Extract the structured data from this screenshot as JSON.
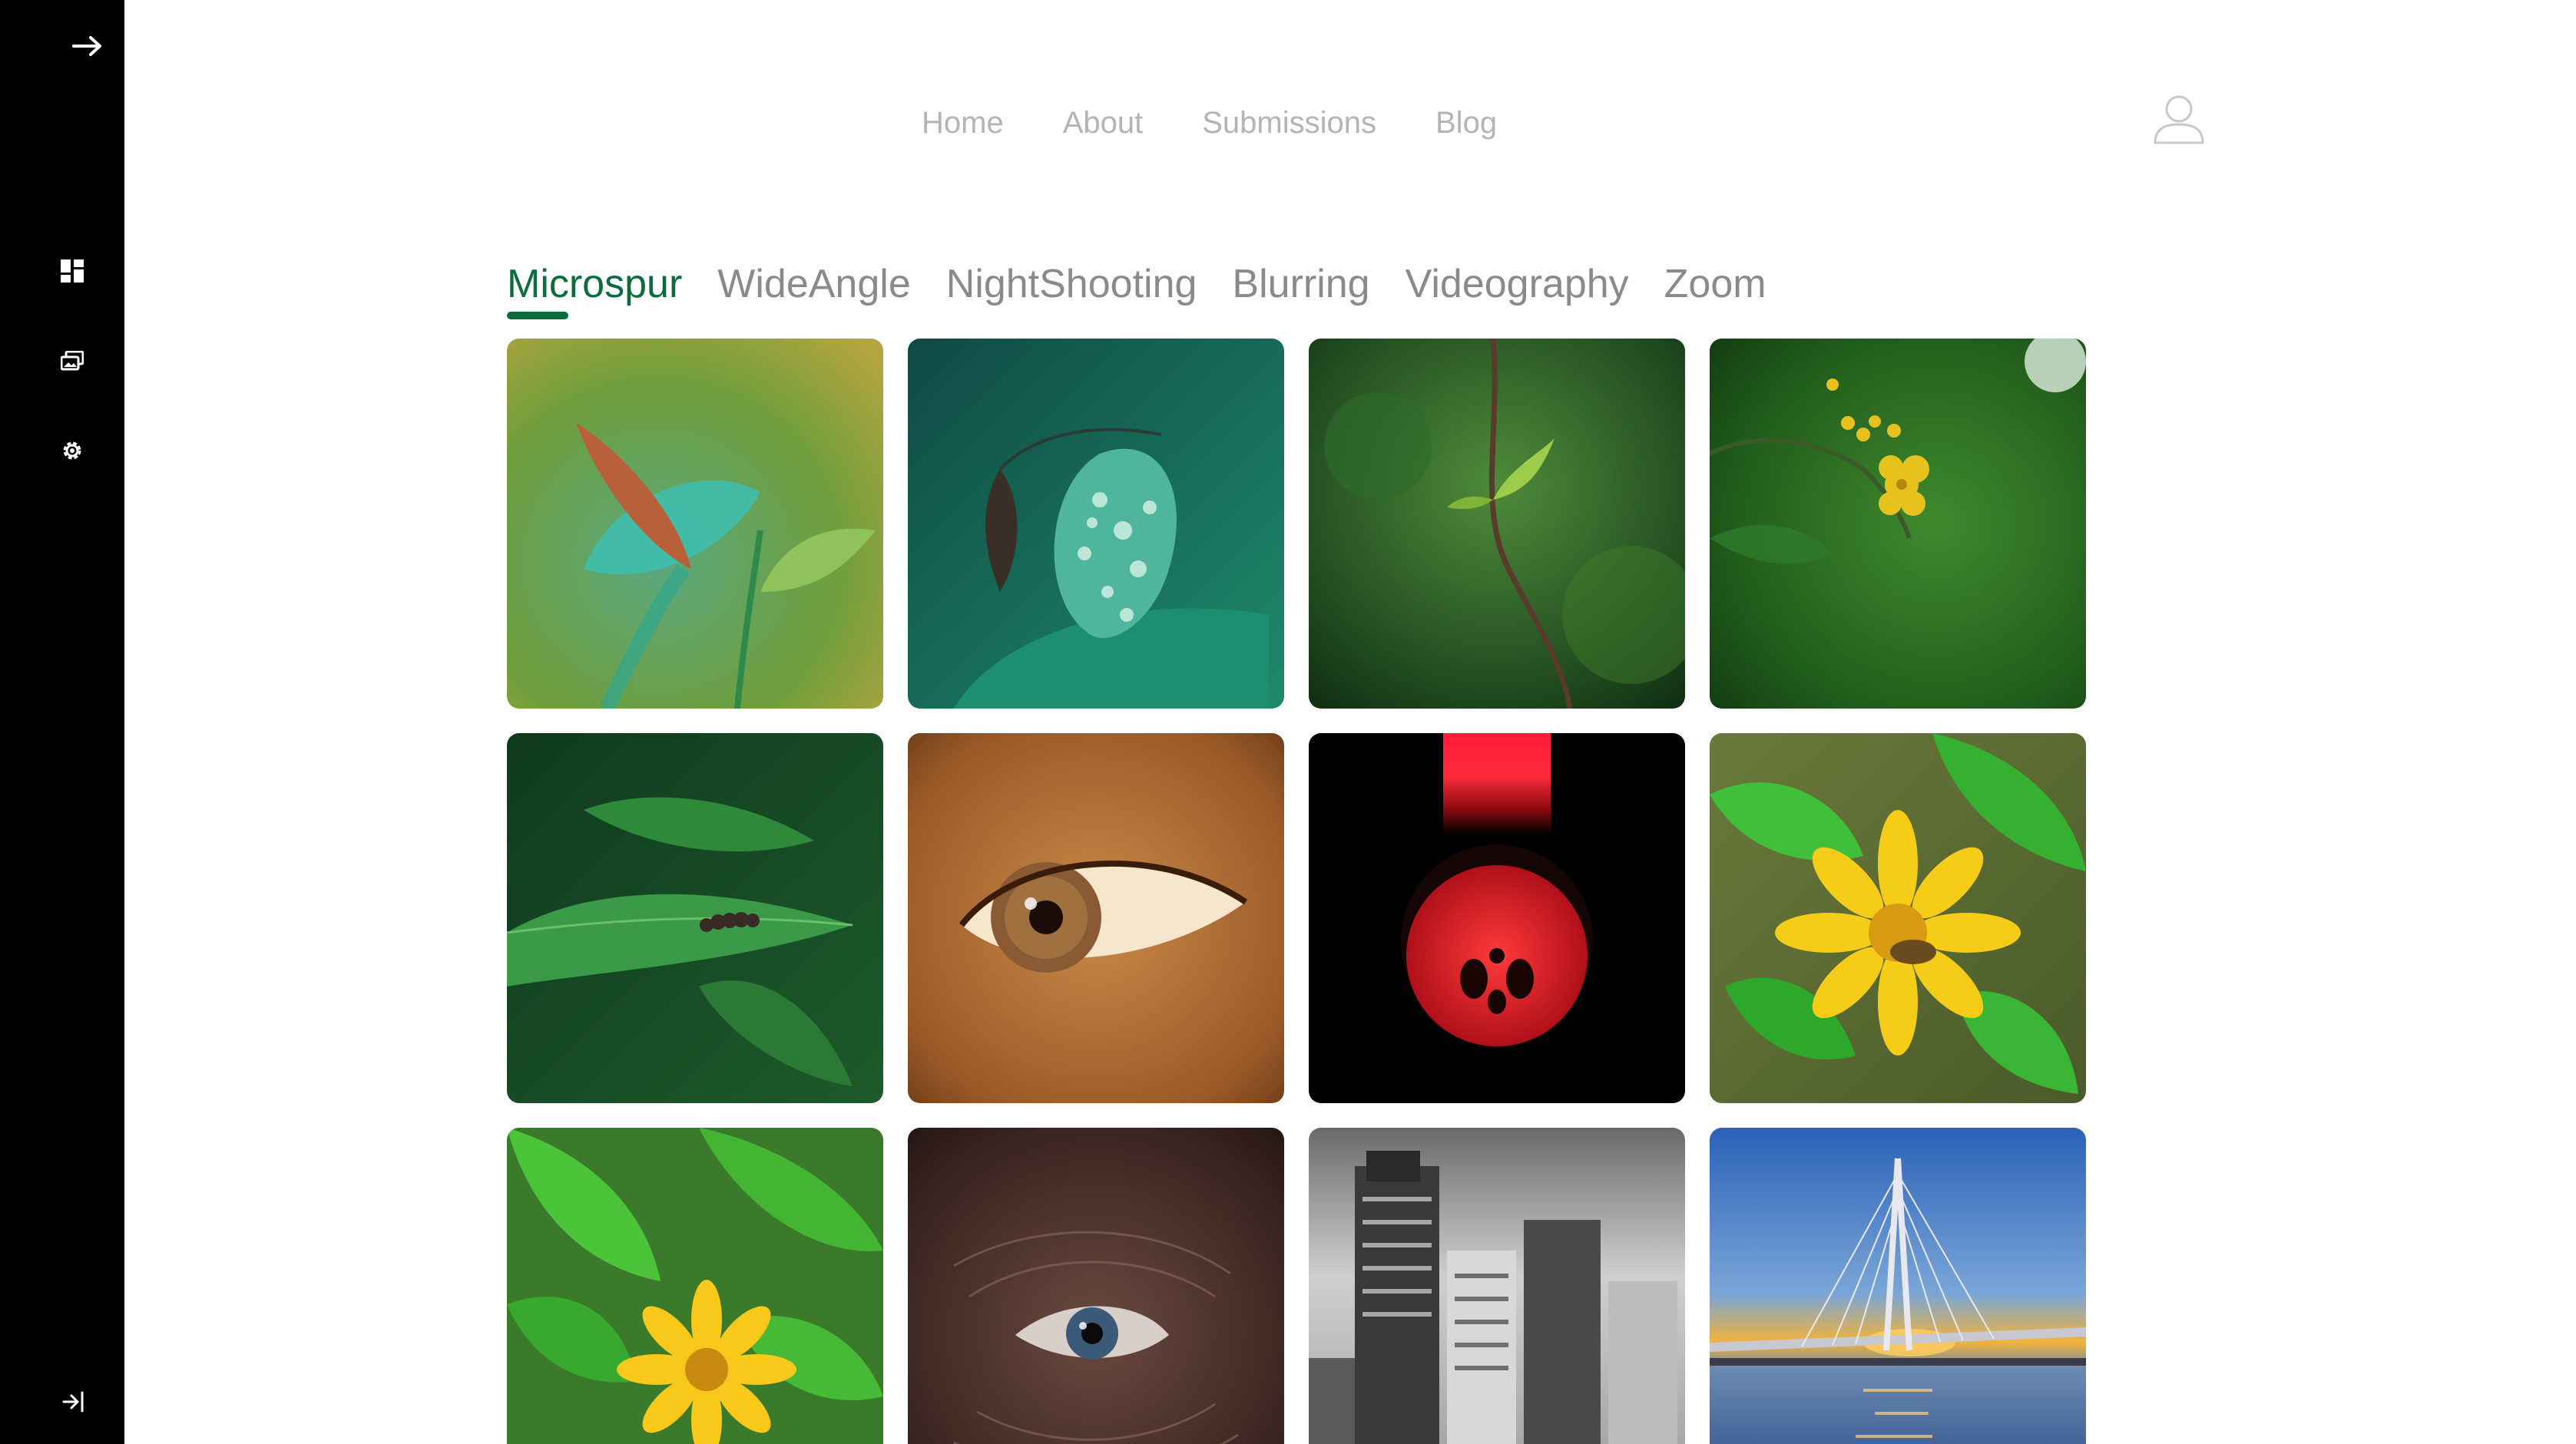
{
  "app": {
    "accent_color": "#0e6b3d",
    "sidebar_color": "#000000"
  },
  "sidebar": {
    "items": [
      {
        "icon": "arrow-right-icon"
      },
      {
        "icon": "dashboard-icon"
      },
      {
        "icon": "gallery-icon"
      },
      {
        "icon": "gear-icon"
      },
      {
        "icon": "logout-icon"
      }
    ]
  },
  "nav": {
    "links": [
      "Home",
      "About",
      "Submissions",
      "Blog"
    ],
    "user_icon": "user-icon"
  },
  "tabs": {
    "items": [
      "Microspur",
      "WideAngle",
      "NightShooting",
      "Blurring",
      "Videography",
      "Zoom"
    ],
    "active": "Microspur"
  },
  "gallery": {
    "photos": [
      {
        "subject": "green leaf shoots"
      },
      {
        "subject": "leaf with water drops"
      },
      {
        "subject": "young sprout on stem"
      },
      {
        "subject": "yellow flowers on branch"
      },
      {
        "subject": "caterpillar on leaf"
      },
      {
        "subject": "close-up brown eye"
      },
      {
        "subject": "red flower under light"
      },
      {
        "subject": "yellow daisy with bee"
      },
      {
        "subject": "yellow flower in green leaves"
      },
      {
        "subject": "close-up eye with wrinkles"
      },
      {
        "subject": "black and white city buildings"
      },
      {
        "subject": "cable bridge at sunset"
      }
    ]
  }
}
